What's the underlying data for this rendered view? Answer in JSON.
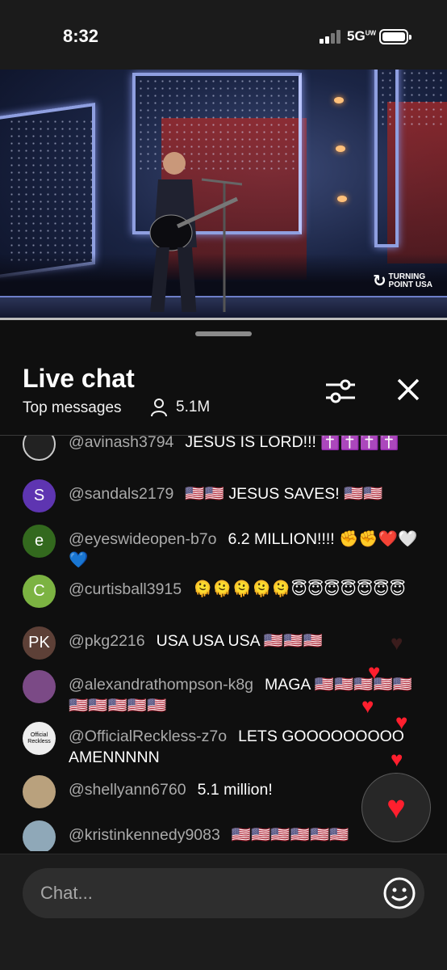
{
  "status_bar": {
    "time": "8:32",
    "network": "5G",
    "network_sup": "UW"
  },
  "video": {
    "logo_line1": "TURNING",
    "logo_line2": "POINT USA"
  },
  "chat": {
    "title": "Live chat",
    "mode": "Top messages",
    "viewer_count": "5.1M",
    "input_placeholder": "Chat...",
    "messages": [
      {
        "avatar_text": "",
        "avatar_color": "#222222",
        "author": "@avinash3794",
        "text": "JESUS IS LORD!!! ✝️✝️✝️✝️"
      },
      {
        "avatar_text": "S",
        "avatar_color": "#5e35b1",
        "author": "@sandals2179",
        "text": "🇺🇸🇺🇸 JESUS SAVES! 🇺🇸🇺🇸"
      },
      {
        "avatar_text": "e",
        "avatar_color": "#33691e",
        "author": "@eyeswideopen-b7o",
        "text": "6.2 MILLION!!!! ✊✊❤️🤍💙"
      },
      {
        "avatar_text": "C",
        "avatar_color": "#7cb342",
        "author": "@curtisball3915",
        "text": "🫠🫠🫠🫠🫠😇😇😇😇😇😇😇"
      },
      {
        "avatar_text": "PK",
        "avatar_color": "#5d4037",
        "author": "@pkg2216",
        "text": "USA USA USA 🇺🇸🇺🇸🇺🇸"
      },
      {
        "avatar_text": "",
        "avatar_color": "#7b4a86",
        "author": "@alexandrathompson-k8g",
        "text": "MAGA 🇺🇸🇺🇸🇺🇸🇺🇸🇺🇸🇺🇸🇺🇸🇺🇸🇺🇸🇺🇸"
      },
      {
        "avatar_text": "Official Reckless",
        "avatar_color": "#eeeeee",
        "author": "@OfficialReckless-z7o",
        "text": "LETS GOOOOOOOOO AMENNNNN"
      },
      {
        "avatar_text": "",
        "avatar_color": "#b9a17d",
        "author": "@shellyann6760",
        "text": "5.1 million!"
      },
      {
        "avatar_text": "",
        "avatar_color": "#8fa8b8",
        "author": "@kristinkennedy9083",
        "text": "🇺🇸🇺🇸🇺🇸🇺🇸🇺🇸🇺🇸"
      }
    ]
  },
  "colors": {
    "background": "#0f0f0f",
    "author": "#aaaaaa",
    "heart": "#ff1f2e"
  },
  "icons": [
    "filter-icon",
    "close-icon",
    "person-icon",
    "smiley-icon",
    "heart-icon"
  ]
}
